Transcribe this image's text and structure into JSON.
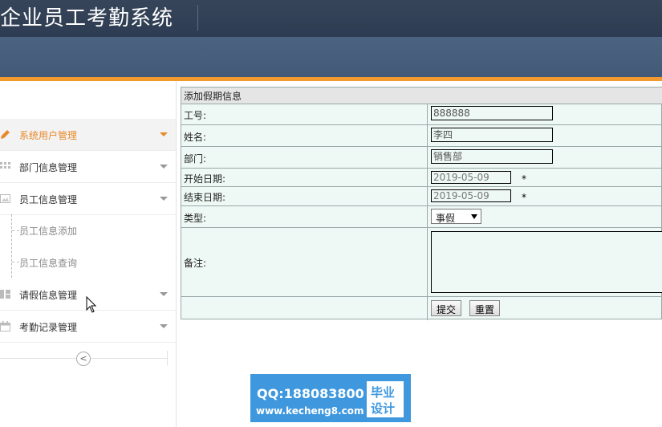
{
  "app": {
    "title": "企业员工考勤系统"
  },
  "sidebar": {
    "items": [
      {
        "label": "系统用户管理",
        "icon": "pencil-icon",
        "active": true
      },
      {
        "label": "部门信息管理",
        "icon": "grid-icon"
      },
      {
        "label": "员工信息管理",
        "icon": "picture-icon"
      },
      {
        "label": "请假信息管理",
        "icon": "columns-icon"
      },
      {
        "label": "考勤记录管理",
        "icon": "calendar-icon"
      }
    ],
    "sub_items": [
      {
        "label": "员工信息添加"
      },
      {
        "label": "员工信息查询"
      }
    ],
    "collapse_glyph": "<"
  },
  "form": {
    "title": "添加假期信息",
    "fields": {
      "emp_no": {
        "label": "工号:",
        "value": "888888"
      },
      "name": {
        "label": "姓名:",
        "value": "李四"
      },
      "dept": {
        "label": "部门:",
        "value": "销售部"
      },
      "start_date": {
        "label": "开始日期:",
        "value": "2019-05-09",
        "required": "*"
      },
      "end_date": {
        "label": "结束日期:",
        "value": "2019-05-09",
        "required": "*"
      },
      "type": {
        "label": "类型:",
        "value": "事假"
      },
      "remark": {
        "label": "备注:",
        "value": ""
      }
    },
    "buttons": {
      "submit": "提交",
      "reset": "重置"
    }
  },
  "watermark": {
    "qq": "QQ:188083800",
    "url": "www.kecheng8.com",
    "badge_line1": "毕业",
    "badge_line2": "设计"
  },
  "colors": {
    "accent": "#f39a2e",
    "header": "#3b4f69",
    "watermark": "#3f98de"
  }
}
